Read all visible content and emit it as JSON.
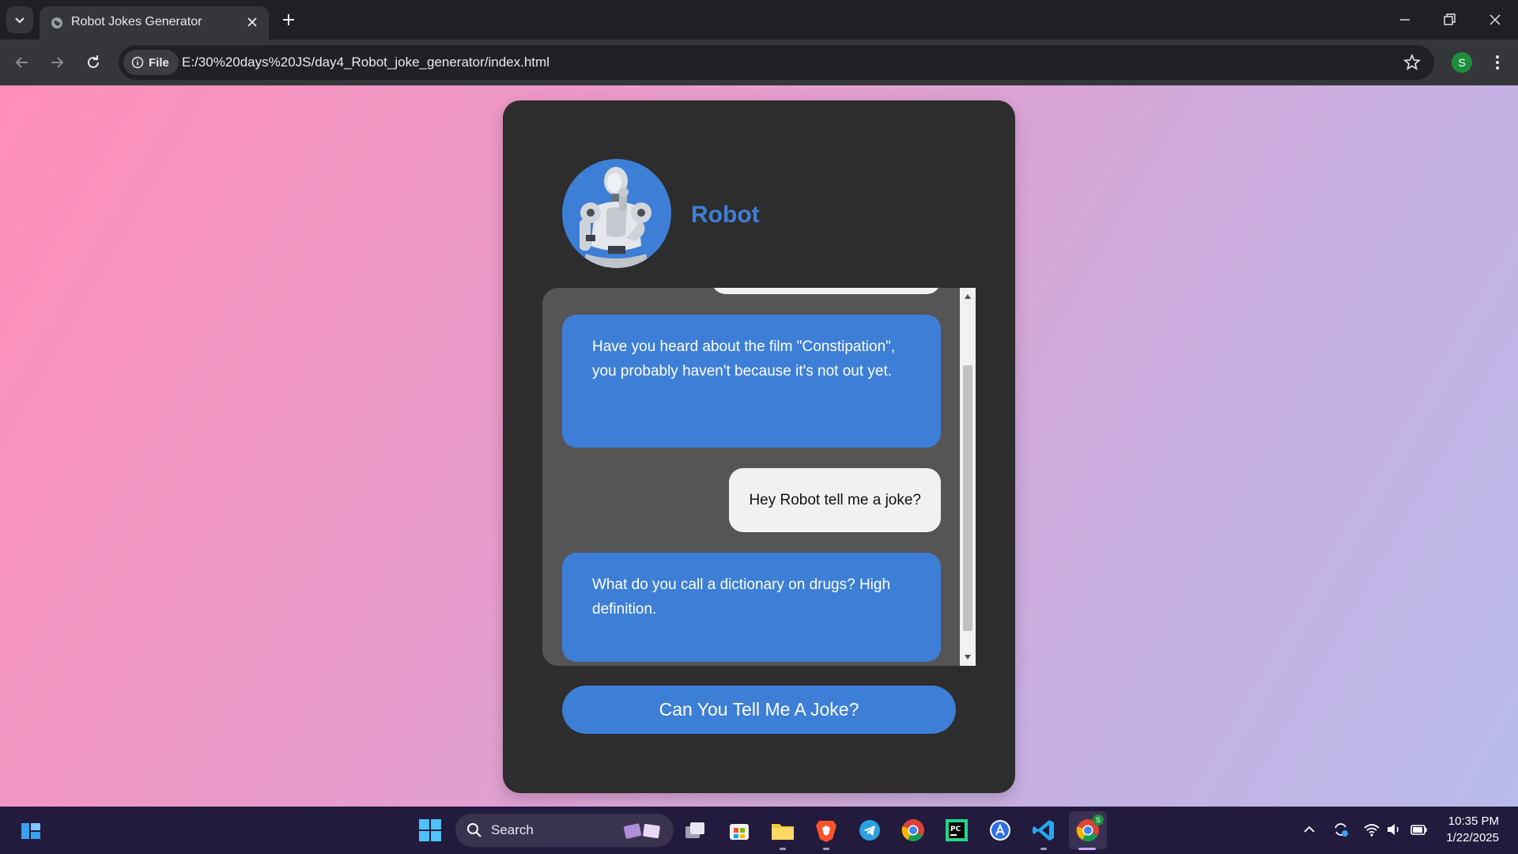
{
  "browser": {
    "tab_title": "Robot Jokes Generator",
    "site_chip": "File",
    "url": "E:/30%20days%20JS/day4_Robot_joke_generator/index.html",
    "profile_initial": "S"
  },
  "app": {
    "robot_name": "Robot",
    "messages": [
      {
        "from": "user",
        "text": ""
      },
      {
        "from": "robot",
        "text": "Have you heard about the film \"Constipation\", you probably haven't because it's not out yet."
      },
      {
        "from": "user",
        "text": "Hey Robot tell me a joke?"
      },
      {
        "from": "robot",
        "text": "What do you call a dictionary on drugs? High definition."
      }
    ],
    "button_label": "Can You Tell Me A Joke?"
  },
  "taskbar": {
    "search_label": "Search",
    "time": "10:35 PM",
    "date": "1/22/2025",
    "chrome_badge": "S"
  },
  "colors": {
    "accent": "#3d7fd6",
    "card": "#2d2d2d",
    "chat_bg": "#555555"
  }
}
